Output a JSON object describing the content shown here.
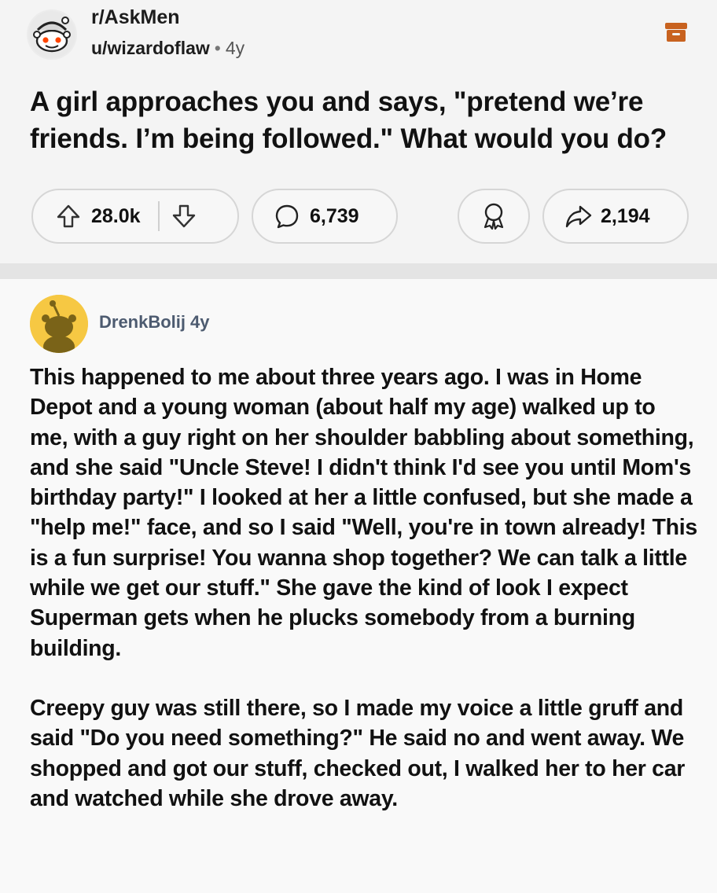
{
  "post": {
    "subreddit": "r/AskMen",
    "author": "u/wizardoflaw",
    "separator": "•",
    "age": "4y",
    "title": "A girl approaches you and says, \"pretend we’re friends. I’m being followed.\" What would you do?",
    "upvotes": "28.0k",
    "comments": "6,739",
    "shares": "2,194"
  },
  "comment": {
    "author": "DrenkBolij",
    "age": "4y",
    "paragraph_1": "This happened to me about three years ago. I was in Home Depot and a young woman (about half my age) walked up to me, with a guy right on her shoulder babbling about something, and she said \"Uncle Steve! I didn't think I'd see you until Mom's birthday party!\" I looked at her a little confused, but she made a \"help me!\" face, and so I said \"Well, you're in town already! This is a fun surprise! You wanna shop together? We can talk a little while we get our stuff.\" She gave the kind of look I expect Superman gets when he plucks somebody from a burning building.",
    "paragraph_2": "Creepy guy was still there, so I made my voice a little gruff and said \"Do you need something?\" He said no and went away. We shopped and got our stuff, checked out, I walked her to her car and watched while she drove away."
  },
  "icons": {
    "subreddit_avatar": "snoo-avatar-icon",
    "archive": "archive-icon",
    "upvote": "upvote-arrow-icon",
    "downvote": "downvote-arrow-icon",
    "comment": "comment-bubble-icon",
    "award": "award-icon",
    "share": "share-arrow-icon",
    "user_avatar": "snoo-silhouette-icon"
  },
  "colors": {
    "archive_icon": "#c8621f",
    "user_avatar_bg": "#f6c843",
    "username": "#4d5b70"
  }
}
